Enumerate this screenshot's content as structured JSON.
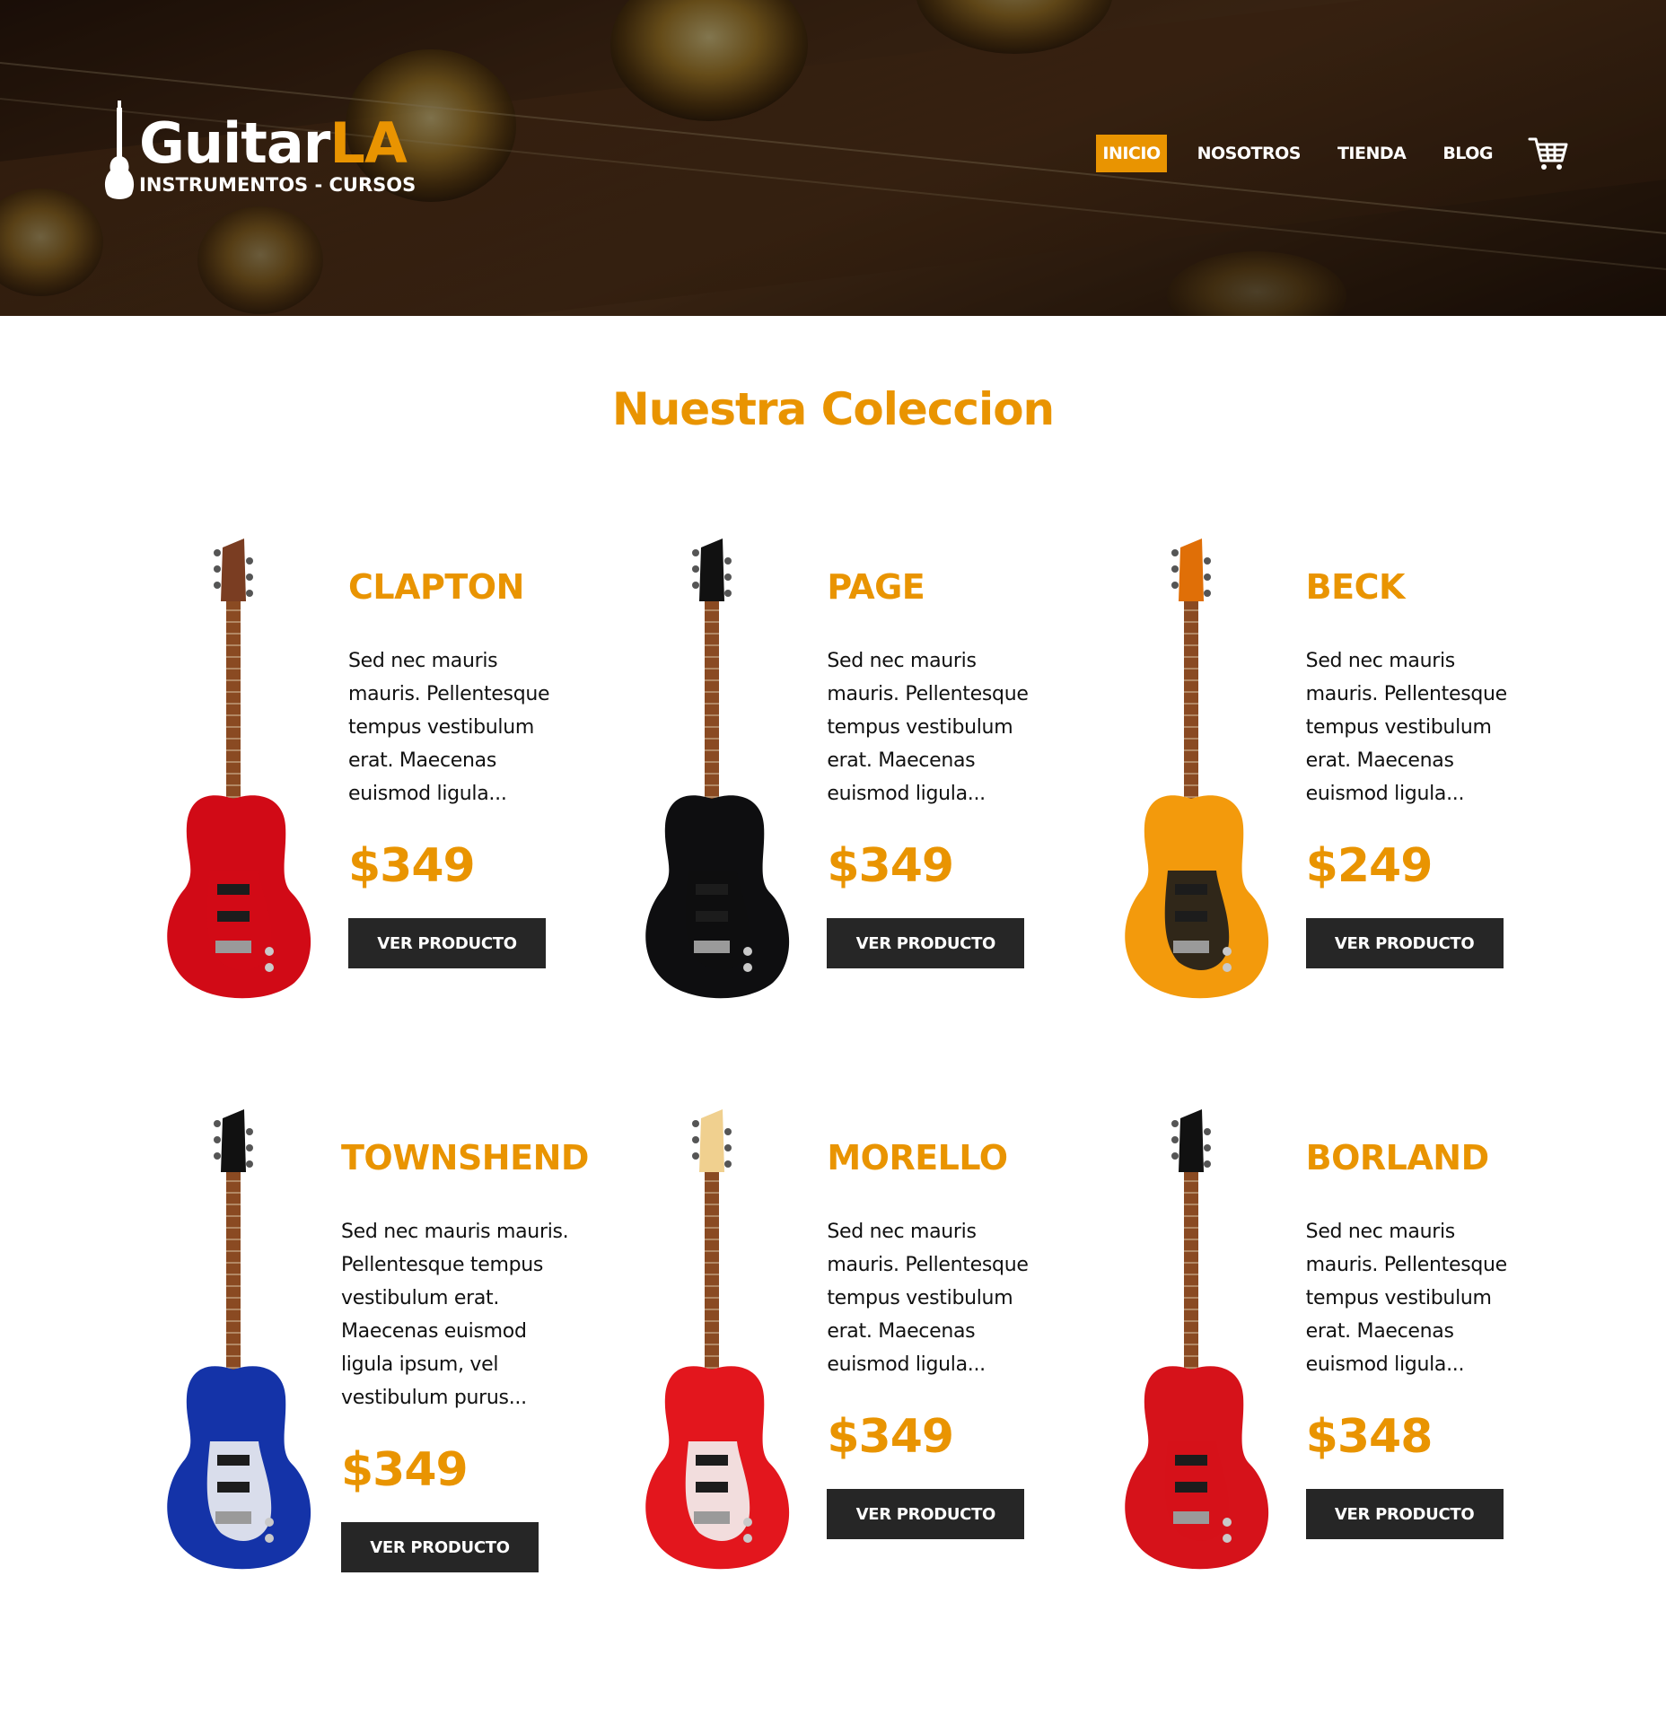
{
  "header": {
    "logo": {
      "name_main": "Guitar",
      "name_accent": "LA",
      "tagline": "INSTRUMENTOS - CURSOS"
    },
    "nav": [
      {
        "label": "INICIO",
        "active": true
      },
      {
        "label": "NOSOTROS",
        "active": false
      },
      {
        "label": "TIENDA",
        "active": false
      },
      {
        "label": "BLOG",
        "active": false
      }
    ],
    "cart_icon": "shopping-cart-icon"
  },
  "main": {
    "title": "Nuestra Coleccion",
    "products": [
      {
        "name": "CLAPTON",
        "description": "Sed nec mauris mauris. Pellentesque tempus vestibulum erat. Maecenas euismod ligula...",
        "price": "$349",
        "button": "VER PRODUCTO",
        "body_color": "#d10a16",
        "pickguard": "#d10a16",
        "headstock": "#7a3d22"
      },
      {
        "name": "PAGE",
        "description": "Sed nec mauris mauris. Pellentesque tempus vestibulum erat. Maecenas euismod ligula...",
        "price": "$349",
        "button": "VER PRODUCTO",
        "body_color": "#0e0e10",
        "pickguard": "#0e0e10",
        "headstock": "#111111"
      },
      {
        "name": "BECK",
        "description": "Sed nec mauris mauris. Pellentesque tempus vestibulum erat. Maecenas euismod ligula...",
        "price": "$249",
        "button": "VER PRODUCTO",
        "body_color": "#f39a0c",
        "pickguard": "#1b1b1b",
        "headstock": "#e06f07"
      },
      {
        "name": "TOWNSHEND",
        "description": "Sed nec mauris mauris. Pellentesque tempus vestibulum erat. Maecenas euismod ligula ipsum, vel vestibulum purus...",
        "price": "$349",
        "button": "VER PRODUCTO",
        "body_color": "#1433a8",
        "pickguard": "#eef0f2",
        "headstock": "#111111"
      },
      {
        "name": "MORELLO",
        "description": "Sed nec mauris mauris. Pellentesque tempus vestibulum erat. Maecenas euismod ligula...",
        "price": "$349",
        "button": "VER PRODUCTO",
        "body_color": "#e3161d",
        "pickguard": "#f3f3f3",
        "headstock": "#f0d08f"
      },
      {
        "name": "BORLAND",
        "description": "Sed nec mauris mauris. Pellentesque tempus vestibulum erat. Maecenas euismod ligula...",
        "price": "$348",
        "button": "VER PRODUCTO",
        "body_color": "#d6121a",
        "pickguard": "#d6121a",
        "headstock": "#111111"
      }
    ]
  },
  "colors": {
    "accent": "#e99401",
    "button_bg": "#262626",
    "text": "#111111"
  }
}
